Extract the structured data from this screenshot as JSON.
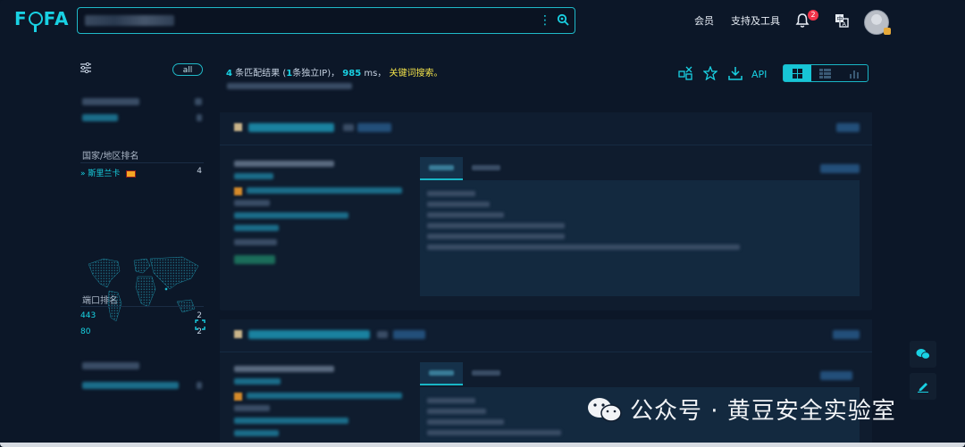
{
  "header": {
    "logo": "FOFA",
    "search_value": "host=\"example.gov.lk\"",
    "nav": [
      "会员",
      "支持及工具"
    ],
    "notification_count": "2"
  },
  "sidebar": {
    "all_label": "all",
    "country_title": "国家/地区排名",
    "country_items": [
      {
        "label": "斯里兰卡",
        "count": "4"
      }
    ],
    "port_title": "端口排名",
    "port_items": [
      {
        "label": "443",
        "count": "2"
      },
      {
        "label": "80",
        "count": "2"
      }
    ]
  },
  "summary": {
    "count": "4",
    "text1": "条匹配结果 (",
    "unique": "1",
    "text2": "条独立IP)，",
    "ms": "985",
    "text3": "ms，",
    "keyword": "关键词搜索。"
  },
  "toolbar": {
    "api_label": "API"
  },
  "watermark": {
    "text": "公众号 · 黄豆安全实验室"
  },
  "colors": {
    "accent": "#19d1e3",
    "keyword": "#f3e34a",
    "badge": "#f2334a",
    "bg": "#0c1728"
  }
}
